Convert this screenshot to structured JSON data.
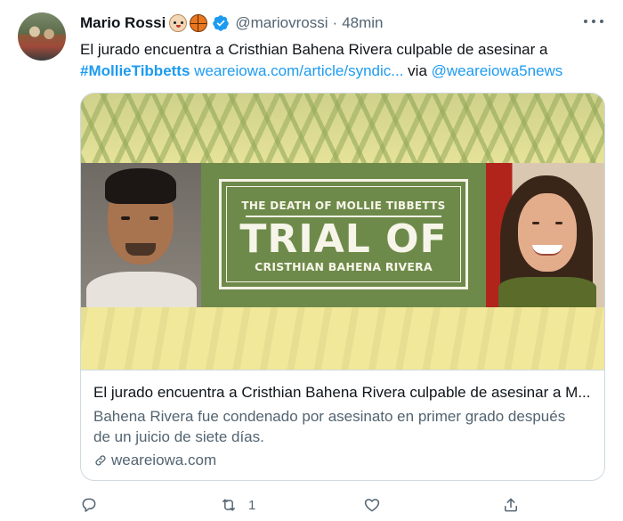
{
  "tweet": {
    "author_name": "Mario Rossi",
    "handle": "@mariovrossi",
    "separator": "·",
    "time": "48min",
    "text_line1": "El jurado encuentra a Cristhian Bahena Rivera culpable de asesinar a",
    "hashtag": "#MollieTibbetts",
    "link": "weareiowa.com/article/syndic...",
    "via_word": "via",
    "mention": "@weareiowa5news"
  },
  "card": {
    "image_text": {
      "small_title": "THE DEATH OF MOLLIE TIBBETTS",
      "big_title": "TRIAL OF",
      "subtitle": "CRISTHIAN BAHENA RIVERA"
    },
    "title": "El jurado encuentra a Cristhian Bahena Rivera culpable de asesinar a M...",
    "description_line1": "Bahena Rivera fue condenado por asesinato en primer grado después",
    "description_line2": "de un juicio de siete días.",
    "domain": "weareiowa.com"
  },
  "actions": {
    "reply_count": "",
    "retweet_count": "1",
    "like_count": "",
    "share_count": ""
  },
  "colors": {
    "accent": "#1d9bf0",
    "text_primary": "#0f1419",
    "text_secondary": "#536471",
    "border": "#cfd9de",
    "banner_green": "#6e8a4a",
    "banner_yellow": "#f0e89c"
  },
  "icons": {
    "avatar": "avatar",
    "emoji_1": "dog-face-icon",
    "emoji_2": "basketball-icon",
    "verified": "verified-badge-icon",
    "more": "more-horizontal-icon",
    "link": "link-icon",
    "reply": "reply-icon",
    "retweet": "retweet-icon",
    "like": "like-icon",
    "share": "share-icon"
  }
}
